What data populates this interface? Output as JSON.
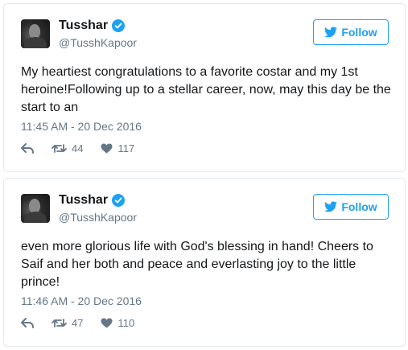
{
  "colors": {
    "accent": "#1da1f2",
    "secondary_text": "#657786",
    "border": "#e1e8ed"
  },
  "tweets": [
    {
      "display_name": "Tusshar",
      "handle": "@TusshKapoor",
      "follow_label": "Follow",
      "text": "My heartiest congratulations to a favorite costar and my 1st heroine!Following up to a stellar career, now, may this day be the start to an",
      "timestamp": "11:45 AM - 20 Dec 2016",
      "retweets": "44",
      "likes": "117"
    },
    {
      "display_name": "Tusshar",
      "handle": "@TusshKapoor",
      "follow_label": "Follow",
      "text": "even more glorious life with God's blessing in hand! Cheers to Saif and her both and peace and everlasting joy to the little prince!",
      "timestamp": "11:46 AM - 20 Dec 2016",
      "retweets": "47",
      "likes": "110"
    }
  ]
}
